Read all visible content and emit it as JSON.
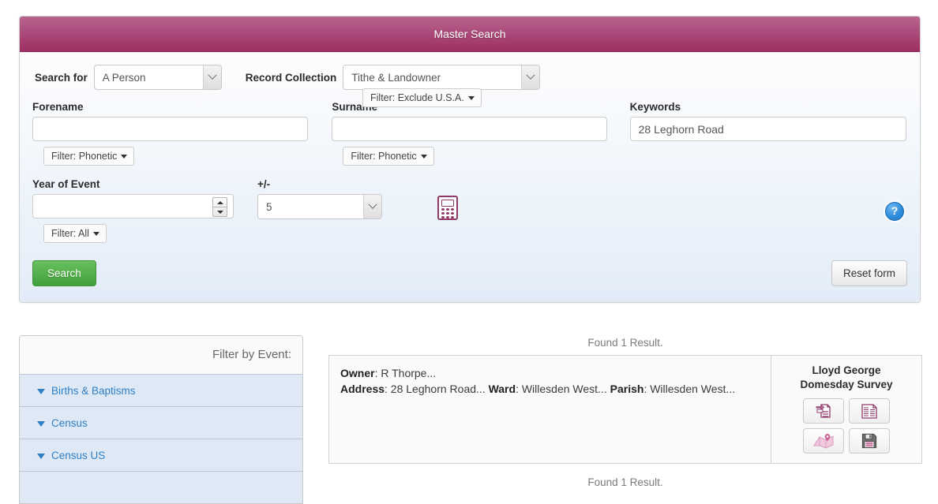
{
  "panel": {
    "title": "Master Search",
    "search_for": {
      "label": "Search for",
      "value": "A Person"
    },
    "record_collection": {
      "label": "Record Collection",
      "value": "Tithe & Landowner",
      "filter_label": "Filter: Exclude U.S.A."
    },
    "forename": {
      "label": "Forename",
      "value": "",
      "filter_label": "Filter: Phonetic"
    },
    "surname": {
      "label": "Surname",
      "value": "",
      "filter_label": "Filter: Phonetic"
    },
    "keywords": {
      "label": "Keywords",
      "value": "28 Leghorn Road"
    },
    "year_of_event": {
      "label": "Year of Event",
      "value": "",
      "filter_label": "Filter: All"
    },
    "plus_minus": {
      "label": "+/-",
      "value": "5"
    },
    "calculator_icon": "calculator-icon",
    "help_icon": "help-icon",
    "help_glyph": "?",
    "search_button": "Search",
    "reset_button": "Reset form"
  },
  "facets": {
    "title": "Filter by Event:",
    "items": [
      {
        "label": "Births & Baptisms"
      },
      {
        "label": "Census"
      },
      {
        "label": "Census US"
      },
      {
        "label": ""
      }
    ]
  },
  "results": {
    "found_top": "Found 1 Result.",
    "found_bottom": "Found 1 Result.",
    "row": {
      "owner_label": "Owner",
      "owner_value": ": R Thorpe...",
      "address_label": "Address",
      "address_value": ": 28 Leghorn Road... ",
      "ward_label": "Ward",
      "ward_value": ": Willesden West... ",
      "parish_label": "Parish",
      "parish_value": ": Willesden West..."
    },
    "side": {
      "title_line1": "Lloyd George",
      "title_line2": "Domesday Survey",
      "buttons": [
        {
          "icon": "document-transfer-icon"
        },
        {
          "icon": "spreadsheet-icon"
        },
        {
          "icon": "map-pin-icon"
        },
        {
          "icon": "save-floppy-icon"
        }
      ]
    }
  },
  "colors": {
    "header_top": "#b8648c",
    "header_bottom": "#9e2f62",
    "accent_magenta": "#8e3a68",
    "link_blue": "#2f7fc4",
    "search_green": "#54b04c",
    "facet_row_bg": "#dfe9f5"
  }
}
